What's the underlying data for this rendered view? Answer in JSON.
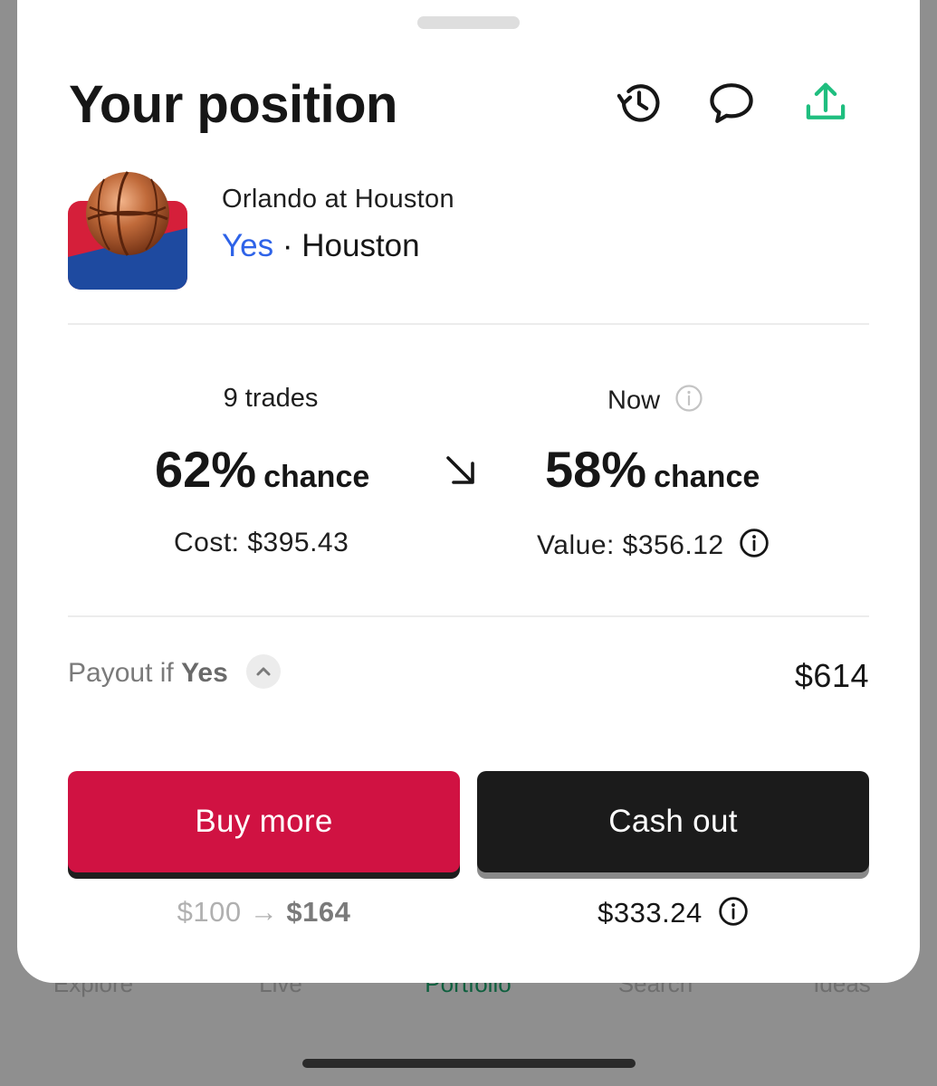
{
  "background_tabs": [
    "Explore",
    "Live",
    "Portfolio",
    "Search",
    "Ideas"
  ],
  "sheet": {
    "title": "Your position",
    "market": {
      "event": "Orlando at Houston",
      "outcome": "Yes",
      "separator": "·",
      "team": "Houston"
    },
    "entry": {
      "caption": "9 trades",
      "percent": "62%",
      "unit": "chance",
      "sub": "Cost: $395.43"
    },
    "now": {
      "caption": "Now",
      "percent": "58%",
      "unit": "chance",
      "sub": "Value: $356.12"
    },
    "payout": {
      "label": "Payout if",
      "outcome": "Yes",
      "value": "$614"
    },
    "buy": {
      "label": "Buy more",
      "from": "$100",
      "arrow": "→",
      "to": "$164"
    },
    "cashout": {
      "label": "Cash out",
      "amount": "$333.24"
    }
  },
  "colors": {
    "accent_green": "#1fbe7f",
    "yes_blue": "#2e63e8",
    "buy_red": "#d01242",
    "cash_black": "#1b1b1b",
    "team_red": "#d51f3a",
    "team_blue": "#1e4aa0"
  },
  "icons": {
    "history": "history-icon",
    "comment": "comment-icon",
    "share": "share-icon",
    "trend": "arrow-down-right-icon",
    "info": "info-icon",
    "chevron": "chevron-up-icon"
  }
}
